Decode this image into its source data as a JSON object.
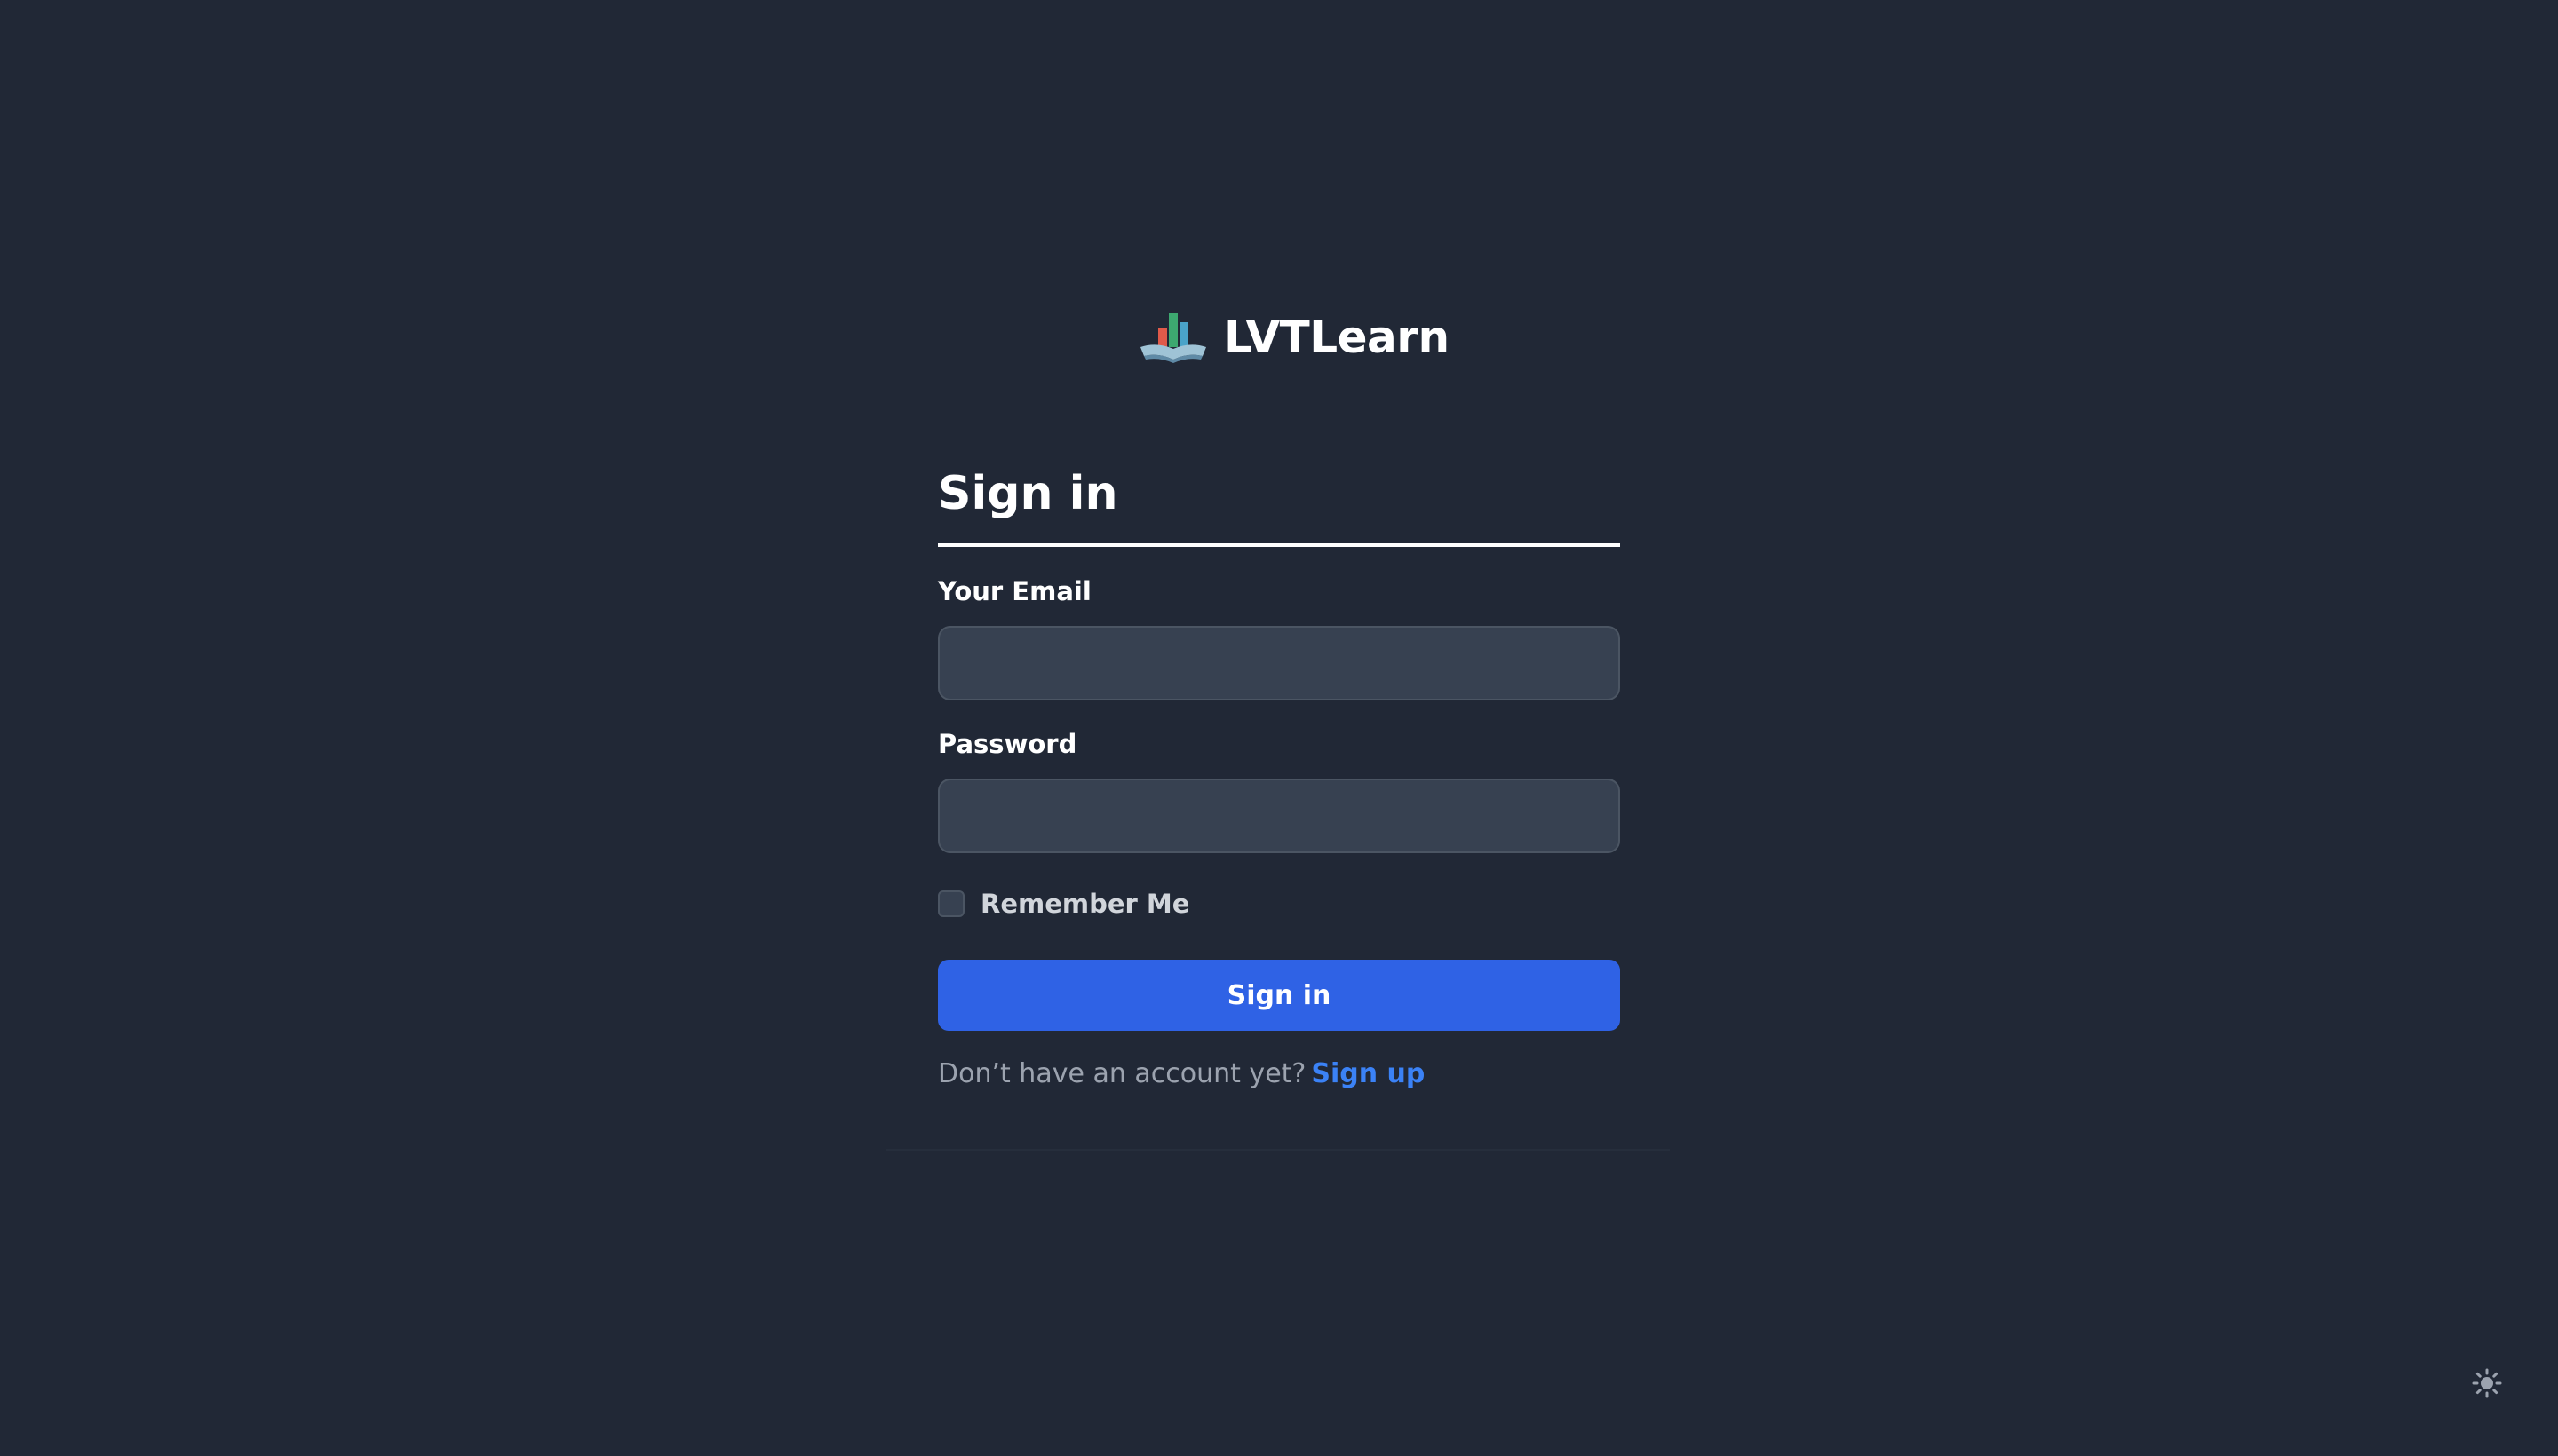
{
  "brand": {
    "name": "LVTLearn",
    "logo_icon": "book-chart-logo-icon"
  },
  "form": {
    "title": "Sign in",
    "email_label": "Your Email",
    "email_value": "",
    "password_label": "Password",
    "password_value": "",
    "remember_label": "Remember Me",
    "remember_checked": false,
    "submit_label": "Sign in",
    "signup_prompt": "Don’t have an account yet?",
    "signup_link": "Sign up"
  },
  "theme_toggle": {
    "icon": "sun-icon"
  },
  "colors": {
    "background": "#212836",
    "input_bg": "#374151",
    "primary": "#2f62e5",
    "link": "#3b82f6"
  }
}
